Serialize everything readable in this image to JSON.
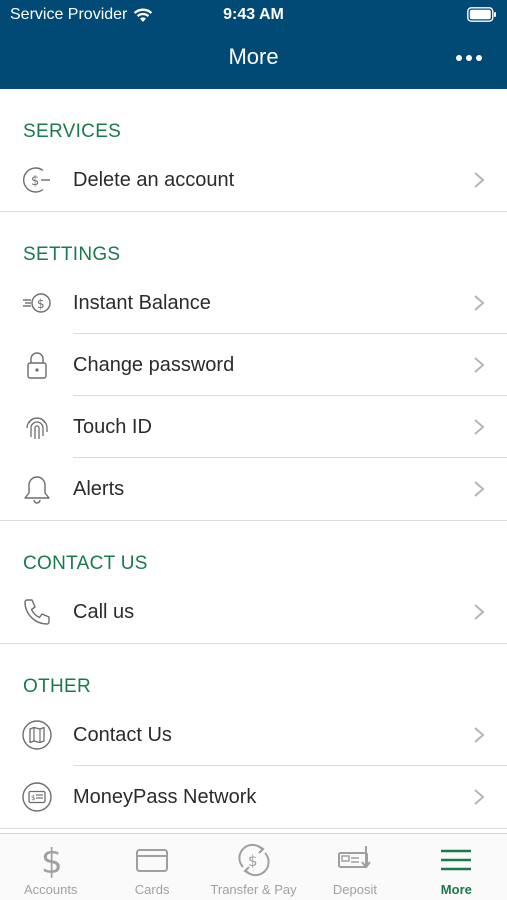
{
  "status_bar": {
    "carrier": "Service Provider",
    "time": "9:43 AM"
  },
  "header": {
    "title": "More",
    "overflow_icon": "ellipsis-icon"
  },
  "sections": [
    {
      "title": "SERVICES",
      "items": [
        {
          "label": "Delete an account",
          "icon": "dollar-remove-icon"
        }
      ]
    },
    {
      "title": "SETTINGS",
      "items": [
        {
          "label": "Instant Balance",
          "icon": "instant-balance-icon"
        },
        {
          "label": "Change password",
          "icon": "lock-icon"
        },
        {
          "label": "Touch ID",
          "icon": "fingerprint-icon"
        },
        {
          "label": "Alerts",
          "icon": "bell-icon"
        }
      ]
    },
    {
      "title": "CONTACT US",
      "items": [
        {
          "label": "Call us",
          "icon": "phone-icon"
        }
      ]
    },
    {
      "title": "OTHER",
      "items": [
        {
          "label": "Contact Us",
          "icon": "map-icon"
        },
        {
          "label": "MoneyPass Network",
          "icon": "atm-card-icon"
        }
      ]
    }
  ],
  "tabs": [
    {
      "label": "Accounts",
      "icon": "dollar-icon",
      "active": false
    },
    {
      "label": "Cards",
      "icon": "card-icon",
      "active": false
    },
    {
      "label": "Transfer & Pay",
      "icon": "transfer-icon",
      "active": false
    },
    {
      "label": "Deposit",
      "icon": "check-deposit-icon",
      "active": false
    },
    {
      "label": "More",
      "icon": "menu-icon",
      "active": true
    }
  ],
  "colors": {
    "header_bg": "#004a75",
    "accent_green": "#1b7a4c",
    "icon_gray": "#6d6d6d",
    "tab_inactive": "#a0a0a0"
  }
}
